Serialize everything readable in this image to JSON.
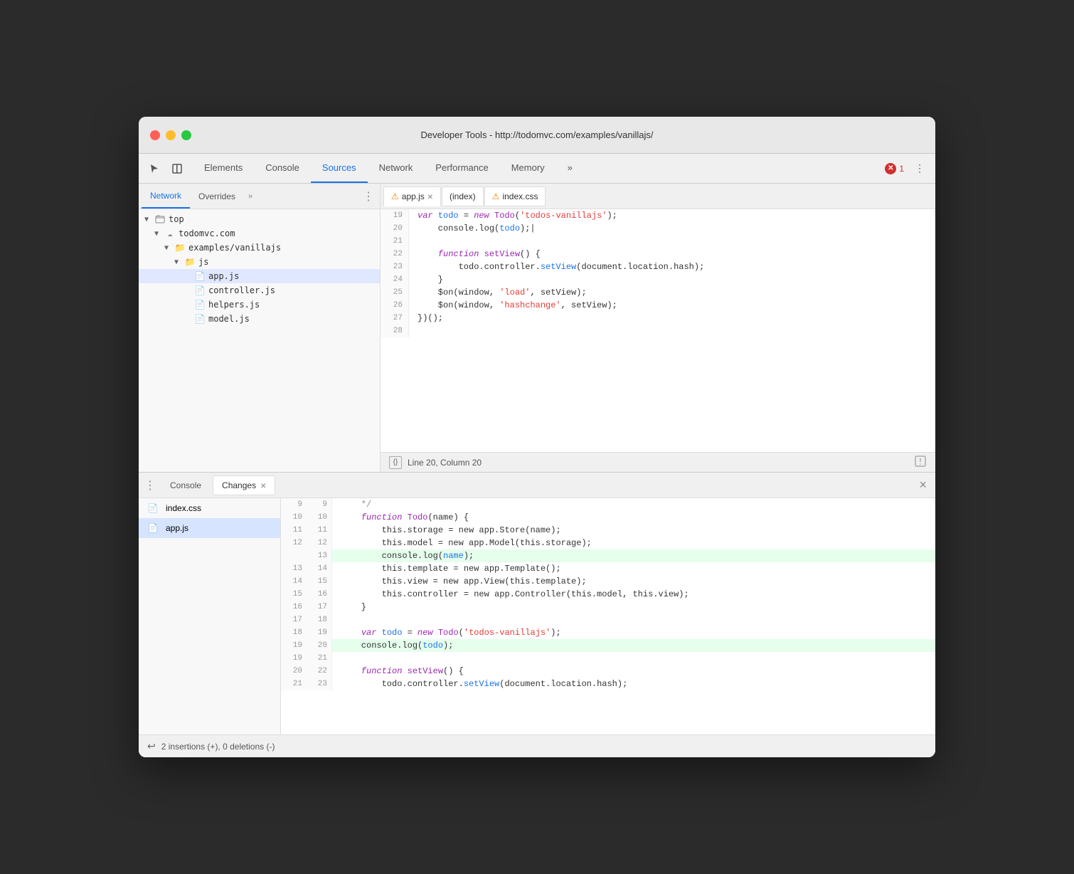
{
  "window": {
    "title": "Developer Tools - http://todomvc.com/examples/vanillajs/",
    "traffic_lights": [
      "red",
      "yellow",
      "green"
    ]
  },
  "toolbar": {
    "tabs": [
      {
        "label": "Elements",
        "active": false
      },
      {
        "label": "Console",
        "active": false
      },
      {
        "label": "Sources",
        "active": true
      },
      {
        "label": "Network",
        "active": false
      },
      {
        "label": "Performance",
        "active": false
      },
      {
        "label": "Memory",
        "active": false
      }
    ],
    "more_label": "»",
    "error_count": "1"
  },
  "sidebar": {
    "tabs": [
      {
        "label": "Network",
        "active": true
      },
      {
        "label": "Overrides",
        "active": false
      },
      {
        "label": "»",
        "is_more": true
      }
    ],
    "tree": [
      {
        "label": "top",
        "indent": 0,
        "type": "arrow-folder",
        "expanded": true
      },
      {
        "label": "todomvc.com",
        "indent": 1,
        "type": "cloud-folder",
        "expanded": true
      },
      {
        "label": "examples/vanillajs",
        "indent": 2,
        "type": "folder",
        "expanded": true
      },
      {
        "label": "js",
        "indent": 3,
        "type": "folder",
        "expanded": true
      },
      {
        "label": "app.js",
        "indent": 4,
        "type": "file-js",
        "selected": true
      },
      {
        "label": "controller.js",
        "indent": 4,
        "type": "file-js"
      },
      {
        "label": "helpers.js",
        "indent": 4,
        "type": "file-js"
      },
      {
        "label": "model.js",
        "indent": 4,
        "type": "file-js"
      }
    ]
  },
  "file_tabs": [
    {
      "label": "app.js",
      "warning": true,
      "active": true,
      "closeable": true
    },
    {
      "label": "(index)",
      "warning": false,
      "active": false,
      "closeable": false
    },
    {
      "label": "index.css",
      "warning": true,
      "active": false,
      "closeable": false
    }
  ],
  "code": {
    "lines": [
      {
        "num": "19",
        "tokens": [
          {
            "t": "kw",
            "v": "var "
          },
          {
            "t": "var-name",
            "v": "todo"
          },
          {
            "t": "plain",
            "v": " = "
          },
          {
            "t": "kw",
            "v": "new "
          },
          {
            "t": "fn",
            "v": "Todo"
          },
          {
            "t": "plain",
            "v": "("
          },
          {
            "t": "str",
            "v": "'todos-vanillajs'"
          },
          {
            "t": "plain",
            "v": ");"
          }
        ]
      },
      {
        "num": "20",
        "tokens": [
          {
            "t": "plain",
            "v": "    console.log("
          },
          {
            "t": "var-name",
            "v": "todo"
          },
          {
            "t": "plain",
            "v": ");|"
          }
        ]
      },
      {
        "num": "21",
        "tokens": []
      },
      {
        "num": "22",
        "tokens": [
          {
            "t": "kw",
            "v": "    function "
          },
          {
            "t": "fn",
            "v": "setView"
          },
          {
            "t": "plain",
            "v": "() {"
          }
        ]
      },
      {
        "num": "23",
        "tokens": [
          {
            "t": "plain",
            "v": "        todo.controller."
          },
          {
            "t": "method",
            "v": "setView"
          },
          {
            "t": "plain",
            "v": "(document.location.hash);"
          }
        ]
      },
      {
        "num": "24",
        "tokens": [
          {
            "t": "plain",
            "v": "    }"
          }
        ]
      },
      {
        "num": "25",
        "tokens": [
          {
            "t": "plain",
            "v": "    $on(window, "
          },
          {
            "t": "str",
            "v": "'load'"
          },
          {
            "t": "plain",
            "v": ", setView);"
          }
        ]
      },
      {
        "num": "26",
        "tokens": [
          {
            "t": "plain",
            "v": "    $on(window, "
          },
          {
            "t": "str",
            "v": "'hashchange'"
          },
          {
            "t": "plain",
            "v": ", setView);"
          }
        ]
      },
      {
        "num": "27",
        "tokens": [
          {
            "t": "plain",
            "v": "})();"
          }
        ]
      },
      {
        "num": "28",
        "tokens": []
      }
    ]
  },
  "status_bar": {
    "format_label": "{}",
    "position": "Line 20, Column 20"
  },
  "bottom_panel": {
    "tabs": [
      {
        "label": "Console",
        "active": false
      },
      {
        "label": "Changes",
        "active": true,
        "closeable": true
      }
    ]
  },
  "changes_files": [
    {
      "label": "index.css",
      "type": "css",
      "selected": false
    },
    {
      "label": "app.js",
      "type": "js",
      "selected": true
    }
  ],
  "diff_lines": [
    {
      "old_num": "9",
      "new_num": "9",
      "content": "    */",
      "type": "context",
      "tokens": [
        {
          "t": "comment",
          "v": "    */"
        }
      ]
    },
    {
      "old_num": "10",
      "new_num": "10",
      "content": "    function Todo(name) {",
      "type": "context",
      "tokens": [
        {
          "t": "kw",
          "v": "    function "
        },
        {
          "t": "fn",
          "v": "Todo"
        },
        {
          "t": "plain",
          "v": "(name) {"
        }
      ]
    },
    {
      "old_num": "11",
      "new_num": "11",
      "content": "        this.storage = new app.Store(name);",
      "type": "context",
      "tokens": [
        {
          "t": "plain",
          "v": "        this.storage = new app.Store(name);"
        }
      ]
    },
    {
      "old_num": "12",
      "new_num": "12",
      "content": "        this.model = new app.Model(this.storage);",
      "type": "context",
      "tokens": [
        {
          "t": "plain",
          "v": "        this.model = new app.Model(this.storage);"
        }
      ]
    },
    {
      "old_num": "",
      "new_num": "13",
      "content": "        console.log(name);",
      "type": "added",
      "tokens": [
        {
          "t": "plain",
          "v": "        console.log("
        },
        {
          "t": "var-name",
          "v": "name"
        },
        {
          "t": "plain",
          "v": ");"
        }
      ]
    },
    {
      "old_num": "13",
      "new_num": "14",
      "content": "        this.template = new app.Template();",
      "type": "context",
      "tokens": [
        {
          "t": "plain",
          "v": "        this.template = new app.Template();"
        }
      ]
    },
    {
      "old_num": "14",
      "new_num": "15",
      "content": "        this.view = new app.View(this.template);",
      "type": "context",
      "tokens": [
        {
          "t": "plain",
          "v": "        this.view = new app.View(this.template);"
        }
      ]
    },
    {
      "old_num": "15",
      "new_num": "16",
      "content": "        this.controller = new app.Controller(this.model, this.view);",
      "type": "context",
      "tokens": [
        {
          "t": "plain",
          "v": "        this.controller = new app.Controller(this.model, this.view);"
        }
      ]
    },
    {
      "old_num": "16",
      "new_num": "17",
      "content": "    }",
      "type": "context",
      "tokens": [
        {
          "t": "plain",
          "v": "    }"
        }
      ]
    },
    {
      "old_num": "17",
      "new_num": "18",
      "content": "",
      "type": "context",
      "tokens": []
    },
    {
      "old_num": "18",
      "new_num": "19",
      "content": "    var todo = new Todo('todos-vanillajs');",
      "type": "context",
      "tokens": [
        {
          "t": "kw",
          "v": "    var "
        },
        {
          "t": "var-name",
          "v": "todo"
        },
        {
          "t": "plain",
          "v": " = "
        },
        {
          "t": "kw",
          "v": "new "
        },
        {
          "t": "fn",
          "v": "Todo"
        },
        {
          "t": "plain",
          "v": "("
        },
        {
          "t": "str",
          "v": "'todos-vanillajs'"
        },
        {
          "t": "plain",
          "v": ");"
        }
      ]
    },
    {
      "old_num": "19",
      "new_num": "20",
      "content": "    console.log(todo);",
      "type": "added",
      "tokens": [
        {
          "t": "plain",
          "v": "    console.log("
        },
        {
          "t": "var-name",
          "v": "todo"
        },
        {
          "t": "plain",
          "v": ");"
        }
      ]
    },
    {
      "old_num": "19",
      "new_num": "21",
      "content": "",
      "type": "context-removed",
      "tokens": []
    },
    {
      "old_num": "20",
      "new_num": "22",
      "content": "    function setView() {",
      "type": "context",
      "tokens": [
        {
          "t": "kw",
          "v": "    function "
        },
        {
          "t": "fn",
          "v": "setView"
        },
        {
          "t": "plain",
          "v": "() {"
        }
      ]
    },
    {
      "old_num": "21",
      "new_num": "23",
      "content": "        todo.controller.setView(document.location.hash);",
      "type": "context",
      "tokens": [
        {
          "t": "plain",
          "v": "        todo.controller."
        },
        {
          "t": "method",
          "v": "setView"
        },
        {
          "t": "plain",
          "v": "(document.location.hash);"
        }
      ]
    }
  ],
  "changes_footer": {
    "summary": "2 insertions (+), 0 deletions (-)"
  }
}
